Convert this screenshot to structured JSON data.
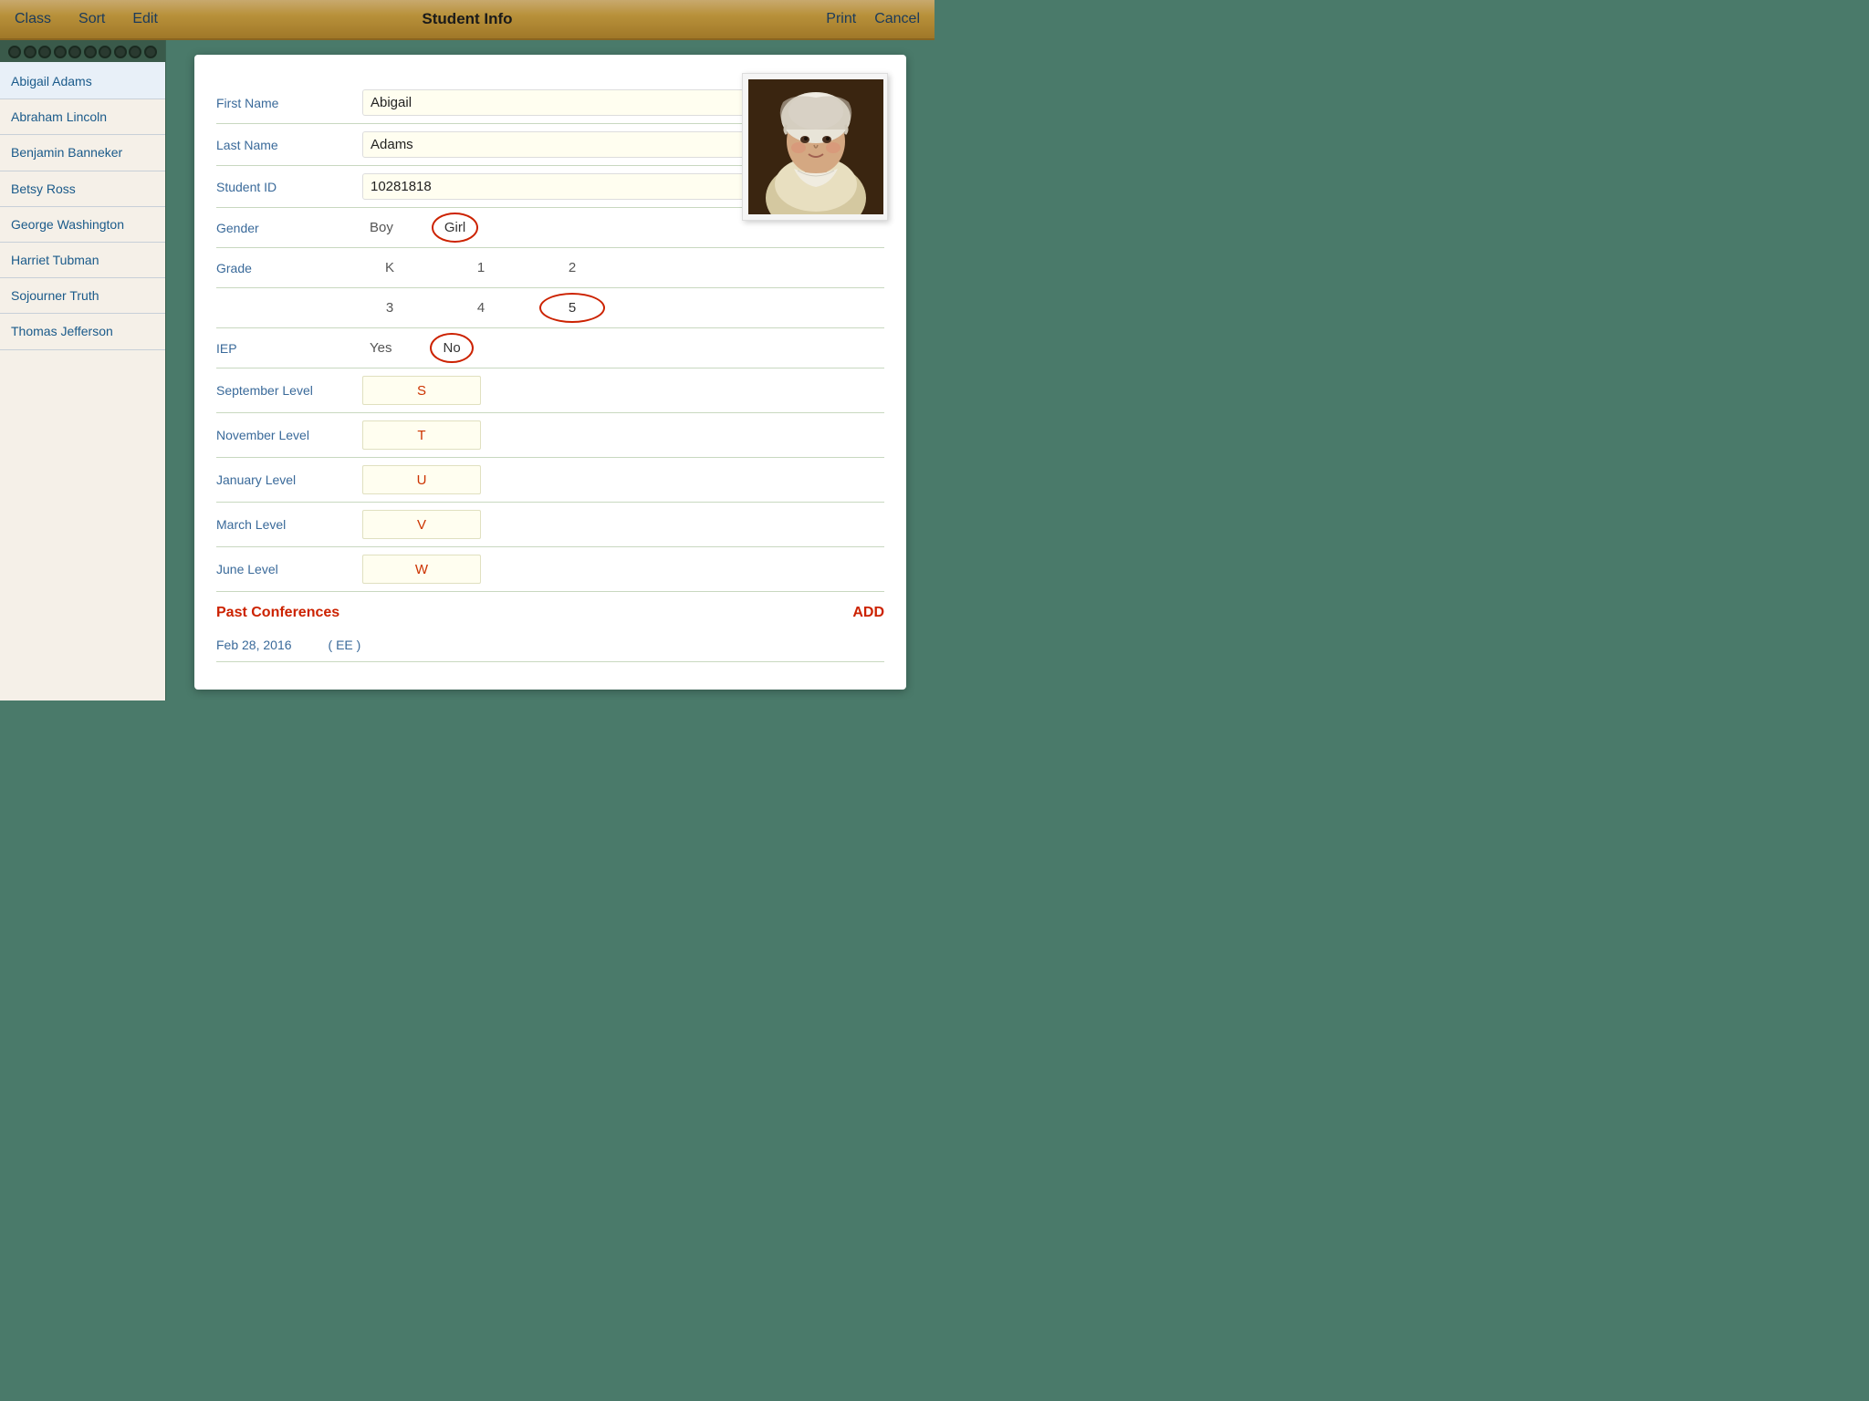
{
  "nav": {
    "class_label": "Class",
    "sort_label": "Sort",
    "edit_label": "Edit",
    "title": "Student Info",
    "print_label": "Print",
    "cancel_label": "Cancel"
  },
  "sidebar": {
    "students": [
      {
        "name": "Abigail Adams"
      },
      {
        "name": "Abraham Lincoln"
      },
      {
        "name": "Benjamin Banneker"
      },
      {
        "name": "Betsy Ross"
      },
      {
        "name": "George Washington"
      },
      {
        "name": "Harriet Tubman"
      },
      {
        "name": "Sojourner Truth"
      },
      {
        "name": "Thomas Jefferson"
      }
    ]
  },
  "student": {
    "first_name_label": "First Name",
    "first_name_value": "Abigail",
    "last_name_label": "Last Name",
    "last_name_value": "Adams",
    "student_id_label": "Student ID",
    "student_id_value": "10281818",
    "gender_label": "Gender",
    "gender_boy": "Boy",
    "gender_girl": "Girl",
    "gender_selected": "Girl",
    "grade_label": "Grade",
    "grade_options": [
      "K",
      "1",
      "2",
      "3",
      "4",
      "5"
    ],
    "grade_selected": "5",
    "iep_label": "IEP",
    "iep_yes": "Yes",
    "iep_no": "No",
    "iep_selected": "No",
    "september_level_label": "September Level",
    "september_level_value": "S",
    "november_level_label": "November Level",
    "november_level_value": "T",
    "january_level_label": "January Level",
    "january_level_value": "U",
    "march_level_label": "March Level",
    "march_level_value": "V",
    "june_level_label": "June Level",
    "june_level_value": "W",
    "past_conferences_label": "Past Conferences",
    "add_label": "ADD",
    "conferences": [
      {
        "date": "Feb 28, 2016",
        "note": "( EE )"
      }
    ]
  }
}
